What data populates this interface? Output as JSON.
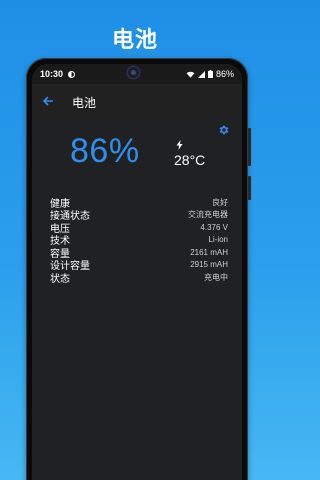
{
  "banner": {
    "title": "电池"
  },
  "statusbar": {
    "time": "10:30",
    "battery": "86%"
  },
  "toolbar": {
    "title": "电池",
    "back_icon": "arrow-back-icon"
  },
  "battery": {
    "percent": "86%",
    "temperature": "28°C",
    "settings_icon": "gear-icon",
    "charging_icon": "lightning-bolt-icon"
  },
  "info": [
    {
      "label": "健康",
      "value": "良好"
    },
    {
      "label": "接通状态",
      "value": "交流充电器"
    },
    {
      "label": "电压",
      "value": "4.376 V"
    },
    {
      "label": "技术",
      "value": "Li-ion"
    },
    {
      "label": "容量",
      "value": "2161 mAH"
    },
    {
      "label": "设计容量",
      "value": "2915 mAH"
    },
    {
      "label": "状态",
      "value": "充电中"
    }
  ],
  "colors": {
    "accent": "#2f8ff0",
    "background": "#202122",
    "banner": "#2b9fec"
  }
}
